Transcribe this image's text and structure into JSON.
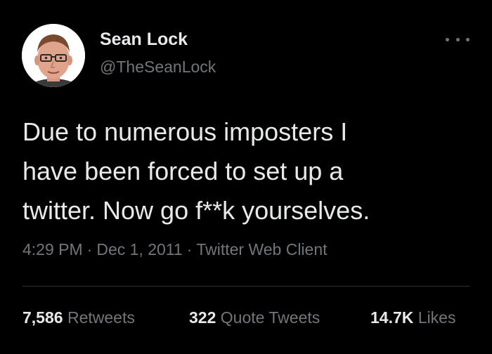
{
  "user": {
    "display_name": "Sean Lock",
    "handle": "@TheSeanLock",
    "avatar": "profile-photo"
  },
  "menu": {
    "icon": "more-horizontal-icon"
  },
  "tweet": {
    "lines": [
      "Due to numerous imposters I",
      "have been forced to set up a",
      "twitter. Now go f**k yourselves."
    ],
    "time": "4:29 PM",
    "date": "Dec 1, 2011",
    "client": "Twitter Web Client",
    "separator": "·"
  },
  "stats": {
    "retweets": {
      "value": "7,586",
      "label": "Retweets"
    },
    "quotes": {
      "value": "322",
      "label": "Quote Tweets"
    },
    "likes": {
      "value": "14.7K",
      "label": "Likes"
    }
  },
  "colors": {
    "background": "#000000",
    "primary_text": "#e7e9ea",
    "secondary_text": "#71767b",
    "divider": "#2f3336"
  }
}
